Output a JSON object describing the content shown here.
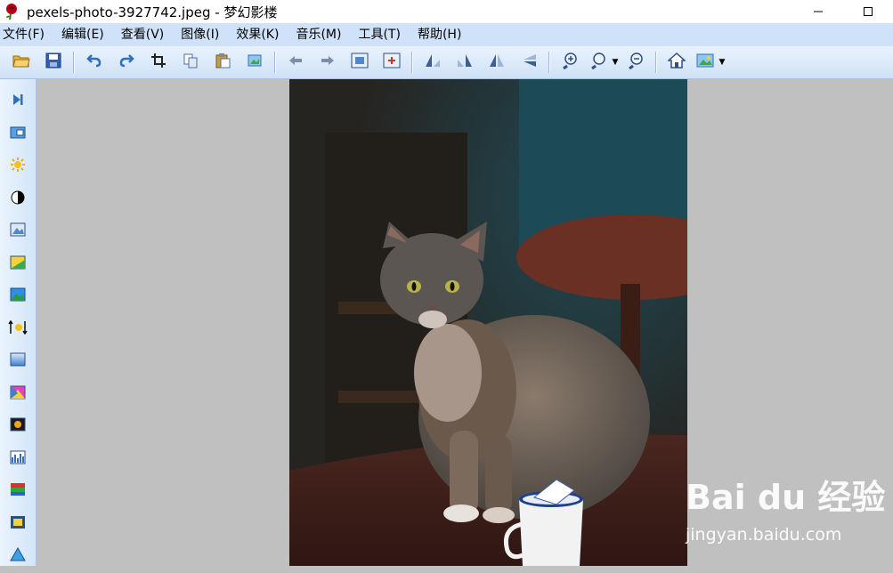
{
  "window": {
    "title": "pexels-photo-3927742.jpeg - 梦幻影楼",
    "app_icon": "rose-icon",
    "controls": [
      "minimize-icon",
      "maximize-icon"
    ]
  },
  "menu": {
    "items": [
      {
        "label": "文件(F)"
      },
      {
        "label": "编辑(E)"
      },
      {
        "label": "查看(V)"
      },
      {
        "label": "图像(I)"
      },
      {
        "label": "效果(K)"
      },
      {
        "label": "音乐(M)"
      },
      {
        "label": "工具(T)"
      },
      {
        "label": "帮助(H)"
      }
    ]
  },
  "toolbar": {
    "buttons": [
      "open-folder-icon",
      "save-icon",
      "undo-icon",
      "redo-icon",
      "crop-icon",
      "copy-icon",
      "paste-icon",
      "export-icon",
      "previous-icon",
      "next-icon",
      "fit-window-icon",
      "actual-size-icon",
      "rotate-left-icon",
      "rotate-right-icon",
      "flip-horizontal-icon",
      "flip-vertical-icon",
      "zoom-in-icon",
      "zoom-icon",
      "zoom-out-icon",
      "home-icon",
      "wallpaper-icon"
    ]
  },
  "sidebar": {
    "tools": [
      "play-end-icon",
      "resize-icon",
      "brightness-icon",
      "contrast-icon",
      "image-adjust-icon",
      "color-balance-icon",
      "landscape-icon",
      "sharpen-icon",
      "gradient-icon",
      "colorize-icon",
      "effects-icon",
      "histogram-icon",
      "rgb-icon",
      "frame-icon",
      "triangle-icon"
    ]
  },
  "watermark": {
    "brand": "Bai du 经验",
    "url": "jingyan.baidu.com"
  },
  "colors": {
    "menu_bg": "#cfe2f9",
    "toolbar_bg": "#dbe9fa",
    "canvas_bg": "#c0c0c0",
    "accent_blue": "#2f6fc1"
  }
}
